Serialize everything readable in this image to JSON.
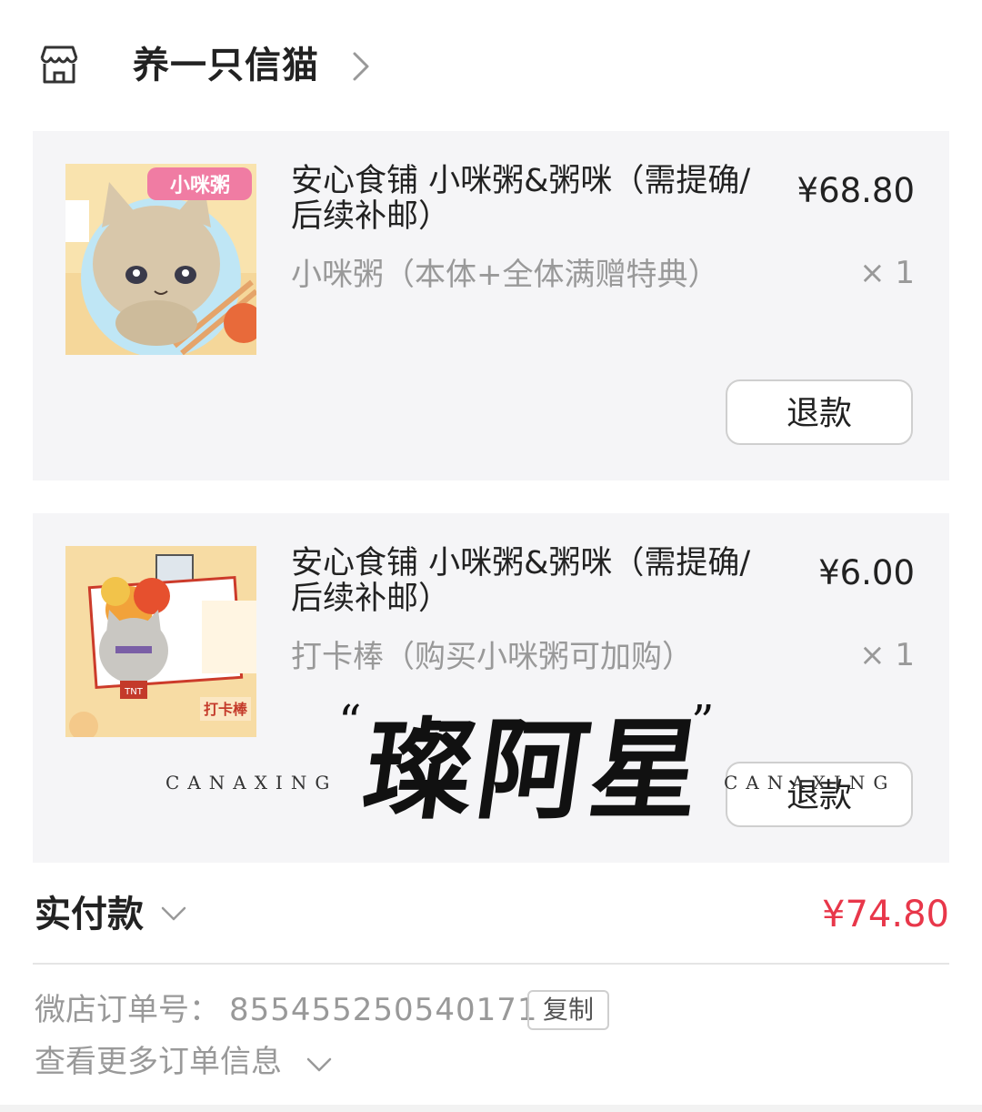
{
  "shop": {
    "name": "养一只信猫",
    "icon": "shop-icon"
  },
  "items": [
    {
      "title": "安心食铺 小咪粥&粥咪（需提确/后续补邮）",
      "spec": "小咪粥（本体+全体满赠特典）",
      "price": "¥68.80",
      "qty": "× 1",
      "refund_label": "退款",
      "thumb_label": "小咪粥"
    },
    {
      "title": "安心食铺 小咪粥&粥咪（需提确/后续补邮）",
      "spec": "打卡棒（购买小咪粥可加购）",
      "price": "¥6.00",
      "qty": "× 1",
      "refund_label": "退款",
      "thumb_label": "打卡棒"
    }
  ],
  "watermark": {
    "en": "CANAXING",
    "cn": "璨阿星"
  },
  "total": {
    "label": "实付款",
    "value": "¥74.80"
  },
  "order": {
    "label": "微店订单号：",
    "number": "855455250540171",
    "copy_label": "复制",
    "more_label": "查看更多订单信息"
  },
  "colors": {
    "accent": "#e8374a",
    "card_bg": "#f5f5f7",
    "muted": "#999999"
  }
}
